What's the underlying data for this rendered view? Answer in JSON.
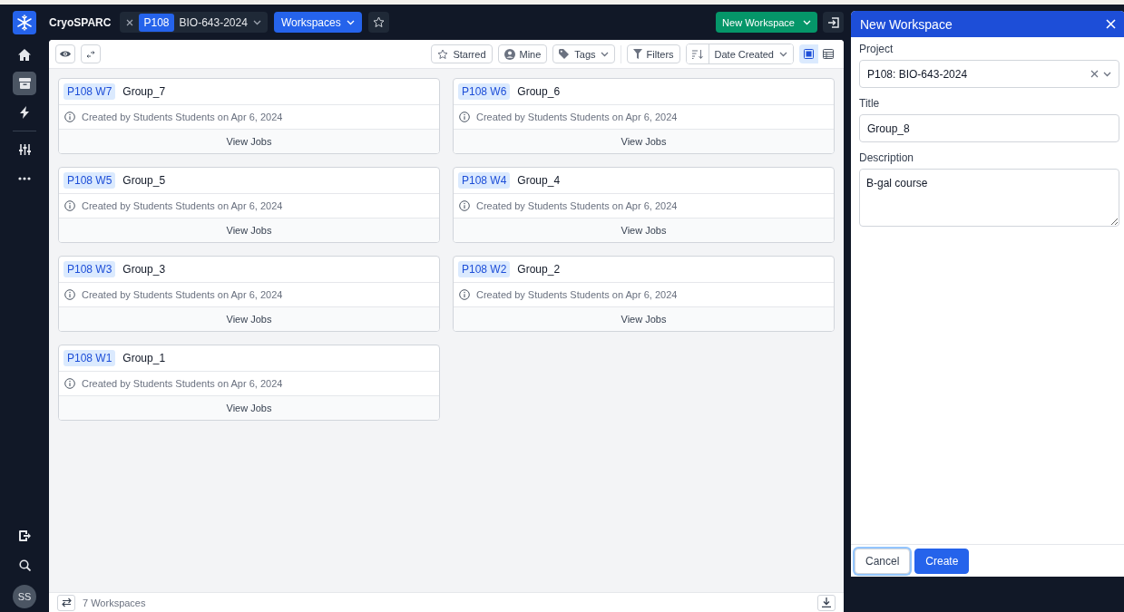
{
  "app": {
    "name": "CryoSPARC"
  },
  "breadcrumb": {
    "project_id": "P108",
    "project_name": "BIO-643-2024",
    "section": "Workspaces",
    "starred": false
  },
  "header_actions": {
    "new_button": "New Workspace"
  },
  "sidebar": {
    "top": [
      {
        "kind": "home",
        "selected": false
      },
      {
        "kind": "archive",
        "selected": true
      },
      {
        "kind": "bolt",
        "selected": false
      },
      {
        "kind": "sliders",
        "selected": false
      },
      {
        "kind": "more",
        "selected": false
      }
    ],
    "bottom": [
      {
        "kind": "exit"
      },
      {
        "kind": "search"
      }
    ],
    "avatar": "SS"
  },
  "toolbar": {
    "toggles": [
      {
        "label": "Starred",
        "kind": "star"
      },
      {
        "label": "Mine",
        "kind": "user"
      },
      {
        "label": "Tags",
        "kind": "tag"
      }
    ],
    "filters": "Filters",
    "sort": "Date Created",
    "views": [
      {
        "kind": "cards",
        "selected": true
      },
      {
        "kind": "table",
        "selected": false
      }
    ]
  },
  "workspaces": [
    {
      "badge": "P108 W7",
      "title": "Group_7",
      "meta": "Created by Students Students on Apr 6, 2024",
      "action": "View Jobs"
    },
    {
      "badge": "P108 W6",
      "title": "Group_6",
      "meta": "Created by Students Students on Apr 6, 2024",
      "action": "View Jobs"
    },
    {
      "badge": "P108 W5",
      "title": "Group_5",
      "meta": "Created by Students Students on Apr 6, 2024",
      "action": "View Jobs"
    },
    {
      "badge": "P108 W4",
      "title": "Group_4",
      "meta": "Created by Students Students on Apr 6, 2024",
      "action": "View Jobs"
    },
    {
      "badge": "P108 W3",
      "title": "Group_3",
      "meta": "Created by Students Students on Apr 6, 2024",
      "action": "View Jobs"
    },
    {
      "badge": "P108 W2",
      "title": "Group_2",
      "meta": "Created by Students Students on Apr 6, 2024",
      "action": "View Jobs"
    },
    {
      "badge": "P108 W1",
      "title": "Group_1",
      "meta": "Created by Students Students on Apr 6, 2024",
      "action": "View Jobs"
    }
  ],
  "footer": {
    "count": "7 Workspaces"
  },
  "drawer": {
    "title": "New Workspace",
    "fields": [
      {
        "label": "Project",
        "kind": "select",
        "value": "P108: BIO-643-2024"
      },
      {
        "label": "Title",
        "kind": "text",
        "value": "Group_8"
      },
      {
        "label": "Description",
        "kind": "textarea",
        "value": "B-gal course"
      }
    ],
    "buttons": [
      {
        "label": "Cancel",
        "kind": "secondary",
        "focused": true
      },
      {
        "label": "Create",
        "kind": "primary",
        "focused": false
      }
    ]
  }
}
